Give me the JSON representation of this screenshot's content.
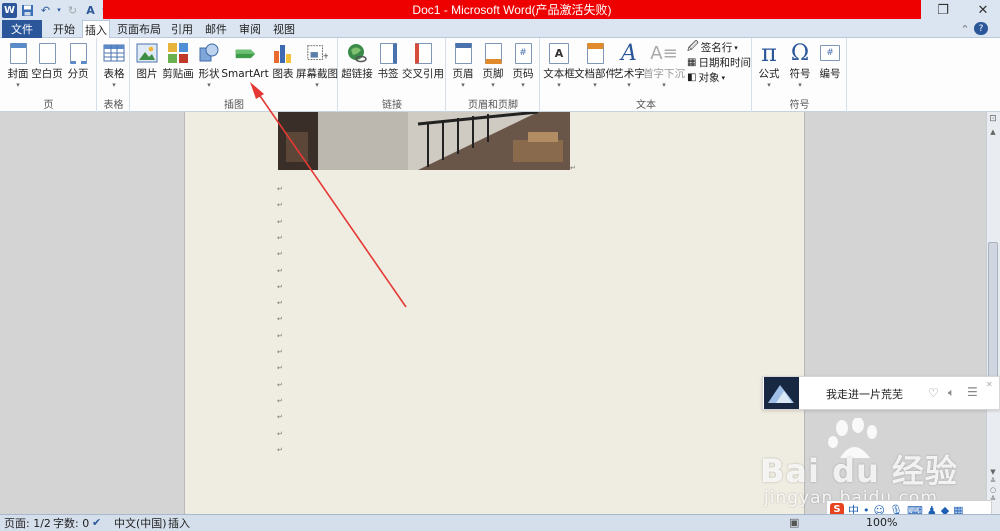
{
  "window": {
    "title": "Doc1 - Microsoft Word(产品激活失败)",
    "restore_icon": "restore-icon",
    "close_icon": "close-icon"
  },
  "quick_access": {
    "app_letter": "W",
    "icons": [
      "save-icon",
      "undo-icon",
      "redo-icon",
      "format-painter-icon",
      "customize-icon"
    ]
  },
  "tabs": {
    "file": "文件",
    "items": [
      "开始",
      "插入",
      "页面布局",
      "引用",
      "邮件",
      "审阅",
      "视图"
    ],
    "active": "插入"
  },
  "ribbon": {
    "groups": {
      "pages": "页",
      "tables": "表格",
      "illustrations": "插图",
      "links": "链接",
      "header_footer": "页眉和页脚",
      "text": "文本",
      "symbols": "符号"
    },
    "buttons": {
      "cover": "封面",
      "blank_page": "空白页",
      "page_break": "分页",
      "table": "表格",
      "picture": "图片",
      "clip_art": "剪贴画",
      "shapes": "形状",
      "smartart": "SmartArt",
      "chart": "图表",
      "screenshot": "屏幕截图",
      "hyperlink": "超链接",
      "bookmark": "书签",
      "cross_ref": "交叉引用",
      "header": "页眉",
      "footer": "页脚",
      "page_number": "页码",
      "text_box": "文本框",
      "quick_parts": "文档部件",
      "wordart": "艺术字",
      "drop_cap": "首字下沉",
      "signature_line": "签名行",
      "date_time": "日期和时间",
      "object": "对象",
      "equation": "公式",
      "symbol": "符号",
      "numbering": "编号"
    },
    "accent_color": "#2b579a"
  },
  "document": {
    "paragraph_mark": "↵",
    "arrow_color": "#e53935"
  },
  "statusbar": {
    "page": "页面: 1/2",
    "words": "字数: 0",
    "language": "中文(中国)",
    "mode": "插入",
    "zoom": "100%"
  },
  "music_popup": {
    "song": "我走进一片荒芜"
  },
  "ime": {
    "logo": "S",
    "mode": "中"
  },
  "watermark": {
    "brand": "Bai du 经验",
    "url": "jingyan.baidu.com"
  }
}
